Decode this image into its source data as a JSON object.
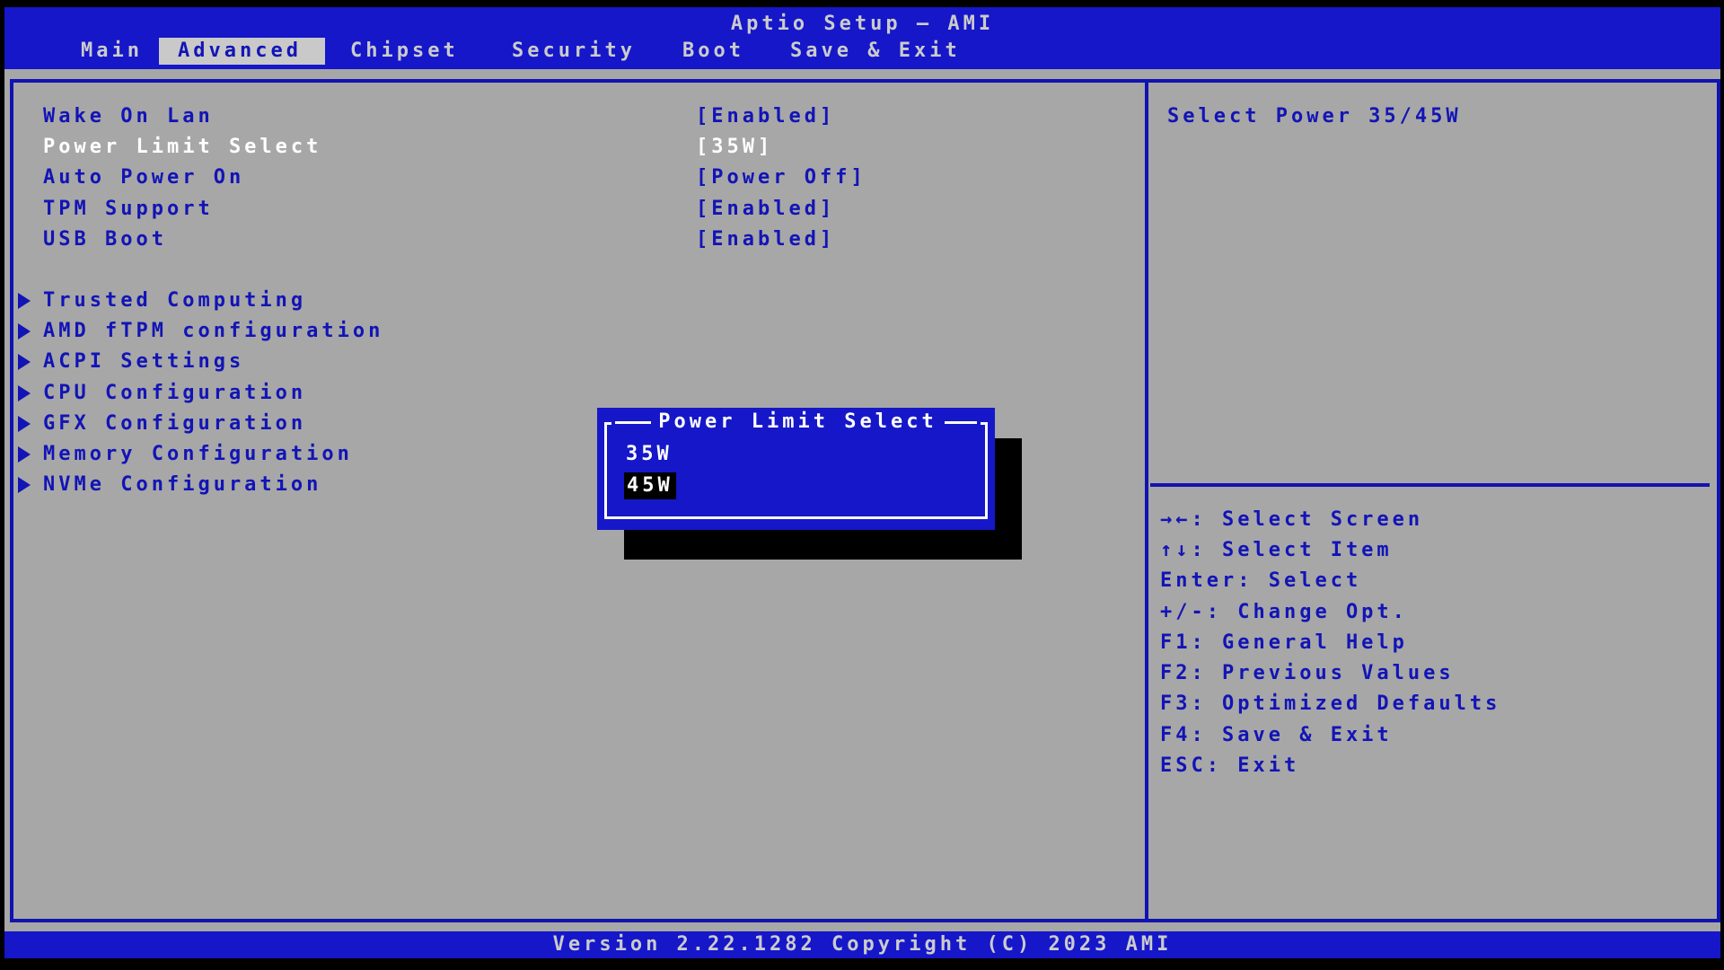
{
  "window": {
    "title": "Aptio Setup – AMI",
    "version_bar": "Version 2.22.1282 Copyright (C) 2023 AMI"
  },
  "menu": {
    "active_tab": "Advanced",
    "tabs": [
      {
        "label": "Main"
      },
      {
        "label": "Advanced"
      },
      {
        "label": "Chipset"
      },
      {
        "label": "Security"
      },
      {
        "label": "Boot"
      },
      {
        "label": "Save & Exit"
      }
    ]
  },
  "options": [
    {
      "label": "Wake On Lan",
      "value": "[Enabled]",
      "selected": false
    },
    {
      "label": "Power Limit Select",
      "value": "[35W]",
      "selected": true
    },
    {
      "label": "Auto Power On",
      "value": "[Power Off]",
      "selected": false
    },
    {
      "label": "TPM Support",
      "value": "[Enabled]",
      "selected": false
    },
    {
      "label": "USB Boot",
      "value": "[Enabled]",
      "selected": false
    }
  ],
  "submenus": [
    {
      "label": "Trusted Computing"
    },
    {
      "label": "AMD fTPM configuration"
    },
    {
      "label": "ACPI Settings"
    },
    {
      "label": "CPU Configuration"
    },
    {
      "label": "GFX Configuration"
    },
    {
      "label": "Memory Configuration"
    },
    {
      "label": "NVMe Configuration"
    }
  ],
  "dialog": {
    "title": "Power Limit Select",
    "options": [
      "35W",
      "45W"
    ],
    "selected": "45W"
  },
  "help": {
    "description": "Select Power 35/45W",
    "keys": [
      "→←: Select Screen",
      "↑↓: Select Item",
      "Enter: Select",
      "+/-: Change Opt.",
      "F1: General Help",
      "F2: Previous Values",
      "F3: Optimized Defaults",
      "F4: Save & Exit",
      "ESC: Exit"
    ]
  },
  "colors": {
    "background_gray": "#a7a7a7",
    "bar_blue": "#1517c9",
    "border_blue": "#1113b0",
    "text_blue": "#1214b6",
    "light_text": "#cbcbcb",
    "highlight_tab_bg": "#c9c9c9",
    "selected_text": "#ffffff",
    "dialog_highlight_bg": "#000000"
  }
}
